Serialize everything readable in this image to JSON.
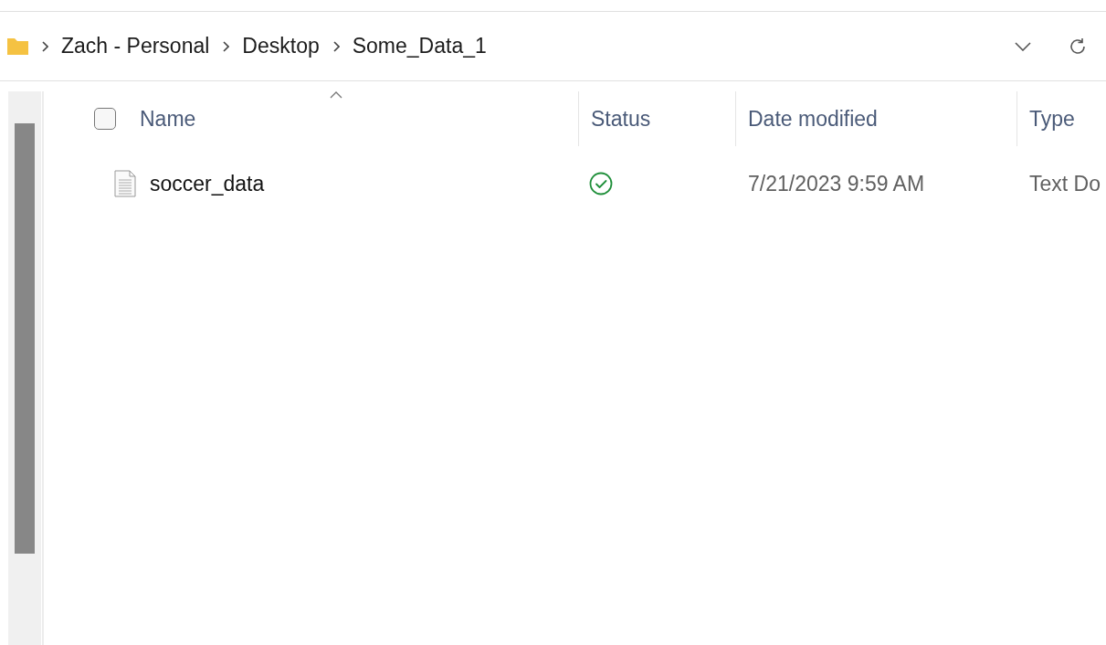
{
  "breadcrumb": [
    "Zach - Personal",
    "Desktop",
    "Some_Data_1"
  ],
  "header": {
    "select_all_checked": false
  },
  "columns": [
    {
      "label": "Name",
      "sorted": true
    },
    {
      "label": "Status",
      "sorted": false
    },
    {
      "label": "Date modified",
      "sorted": false
    },
    {
      "label": "Type",
      "sorted": false
    }
  ],
  "rows": [
    {
      "name": "soccer_data",
      "synced": true,
      "date_modified": "7/21/2023 9:59 AM",
      "type": "Text Do"
    }
  ]
}
